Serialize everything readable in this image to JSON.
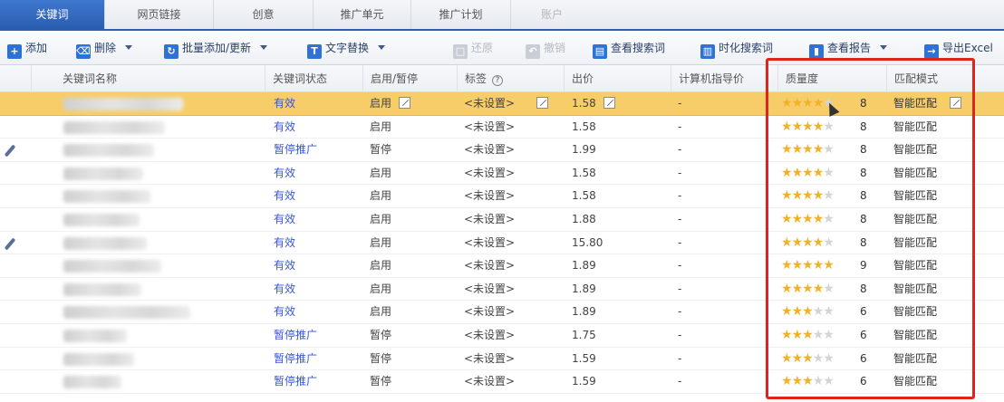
{
  "tabs": [
    {
      "label": "关键词",
      "active": true
    },
    {
      "label": "网页链接"
    },
    {
      "label": "创意"
    },
    {
      "label": "推广单元"
    },
    {
      "label": "推广计划"
    },
    {
      "label": "账户",
      "disabled": true
    }
  ],
  "toolbar": {
    "add": "添加",
    "delete": "删除",
    "batch": "批量添加/更新",
    "replace": "文字替换",
    "restore": "还原",
    "undo": "撤销",
    "search_words": "查看搜索词",
    "timely_search": "时化搜索词",
    "report": "查看报告",
    "export": "导出Excel"
  },
  "columns": {
    "name": "关键词名称",
    "status": "关键词状态",
    "enable": "启用/暂停",
    "url": "标签",
    "bid": "出价",
    "pc_bid": "计算机指导价",
    "quality": "质量度",
    "match": "匹配模式"
  },
  "rows": [
    {
      "status": "有效",
      "enable": "启用",
      "url": "<未设置>",
      "bid": "1.58",
      "pc": "-",
      "stars": 4,
      "q": "8",
      "match": "智能匹配",
      "selected": true,
      "blur_w": 132
    },
    {
      "status": "有效",
      "enable": "启用",
      "url": "<未设置>",
      "bid": "1.58",
      "pc": "-",
      "stars": 4,
      "q": "8",
      "match": "智能匹配",
      "blur_w": 112
    },
    {
      "status": "暂停推广",
      "enable": "暂停",
      "url": "<未设置>",
      "bid": "1.99",
      "pc": "-",
      "stars": 4,
      "q": "8",
      "match": "智能匹配",
      "pencil": true,
      "blur_w": 100
    },
    {
      "status": "有效",
      "enable": "启用",
      "url": "<未设置>",
      "bid": "1.58",
      "pc": "-",
      "stars": 4,
      "q": "8",
      "match": "智能匹配",
      "blur_w": 88
    },
    {
      "status": "有效",
      "enable": "启用",
      "url": "<未设置>",
      "bid": "1.58",
      "pc": "-",
      "stars": 4,
      "q": "8",
      "match": "智能匹配",
      "blur_w": 96
    },
    {
      "status": "有效",
      "enable": "启用",
      "url": "<未设置>",
      "bid": "1.88",
      "pc": "-",
      "stars": 4,
      "q": "8",
      "match": "智能匹配",
      "blur_w": 84
    },
    {
      "status": "有效",
      "enable": "启用",
      "url": "<未设置>",
      "bid": "15.80",
      "pc": "-",
      "stars": 4,
      "q": "8",
      "match": "智能匹配",
      "pencil": true,
      "blur_w": 92
    },
    {
      "status": "有效",
      "enable": "启用",
      "url": "<未设置>",
      "bid": "1.89",
      "pc": "-",
      "stars": 5,
      "q": "9",
      "match": "智能匹配",
      "blur_w": 108
    },
    {
      "status": "有效",
      "enable": "启用",
      "url": "<未设置>",
      "bid": "1.89",
      "pc": "-",
      "stars": 4,
      "q": "8",
      "match": "智能匹配",
      "blur_w": 86
    },
    {
      "status": "有效",
      "enable": "启用",
      "url": "<未设置>",
      "bid": "1.89",
      "pc": "-",
      "stars": 3,
      "q": "6",
      "match": "智能匹配",
      "blur_w": 140
    },
    {
      "status": "暂停推广",
      "enable": "暂停",
      "url": "<未设置>",
      "bid": "1.75",
      "pc": "-",
      "stars": 3,
      "q": "6",
      "match": "智能匹配",
      "blur_w": 70
    },
    {
      "status": "暂停推广",
      "enable": "暂停",
      "url": "<未设置>",
      "bid": "1.59",
      "pc": "-",
      "stars": 3,
      "q": "6",
      "match": "智能匹配",
      "blur_w": 78
    },
    {
      "status": "暂停推广",
      "enable": "暂停",
      "url": "<未设置>",
      "bid": "1.59",
      "pc": "-",
      "stars": 3,
      "q": "6",
      "match": "智能匹配",
      "blur_w": 64
    }
  ],
  "colors": {
    "accent": "#2a5db0",
    "selected_row": "#f7cd6a",
    "highlight": "#e2221f",
    "star": "#f0b22a"
  }
}
